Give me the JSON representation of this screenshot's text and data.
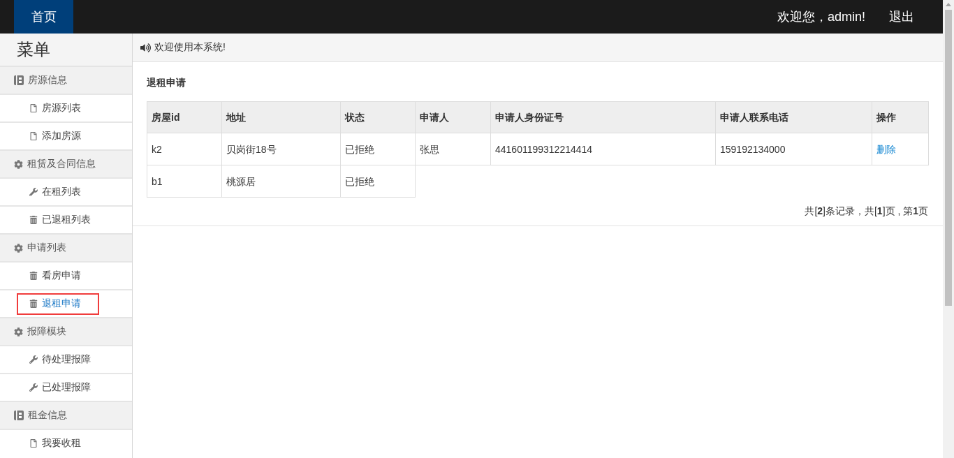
{
  "topbar": {
    "home_tab": {
      "label": "首页",
      "selected": true
    },
    "greeting": "欢迎您，admin!",
    "logout": "退出"
  },
  "sidebar": {
    "title": "菜单",
    "groups": [
      {
        "label": "房源信息",
        "children": [
          {
            "label": "房源列表",
            "selected": false,
            "highlighted": false
          },
          {
            "label": "添加房源",
            "selected": false,
            "highlighted": false
          }
        ]
      },
      {
        "label": "租赁及合同信息",
        "children": [
          {
            "label": "在租列表",
            "selected": false,
            "highlighted": false
          },
          {
            "label": "已退租列表",
            "selected": false,
            "highlighted": false
          }
        ]
      },
      {
        "label": "申请列表",
        "children": [
          {
            "label": "看房申请",
            "selected": false,
            "highlighted": false
          },
          {
            "label": "退租申请",
            "selected": true,
            "highlighted": true
          }
        ]
      },
      {
        "label": "报障模块",
        "children": [
          {
            "label": "待处理报障",
            "selected": false,
            "highlighted": false
          },
          {
            "label": "已处理报障",
            "selected": false,
            "highlighted": false
          }
        ]
      },
      {
        "label": "租金信息",
        "children": [
          {
            "label": "我要收租",
            "selected": false,
            "highlighted": false
          }
        ]
      }
    ]
  },
  "notice": "欢迎使用本系统!",
  "panel": {
    "title": "退租申请",
    "table": {
      "columns": [
        "房屋id",
        "地址",
        "状态",
        "申请人",
        "申请人身份证号",
        "申请人联系电话",
        "操作"
      ],
      "rows": [
        {
          "cells": [
            "k2",
            "贝岗街18号",
            "已拒绝",
            "张思",
            "441601199312214414",
            "159192134000"
          ],
          "action": "删除"
        },
        {
          "cells": [
            "b1",
            "桃源居",
            "已拒绝"
          ]
        }
      ]
    },
    "pagination": "共[**2**]条记录，共[**1**]页 , 第**1**页"
  }
}
